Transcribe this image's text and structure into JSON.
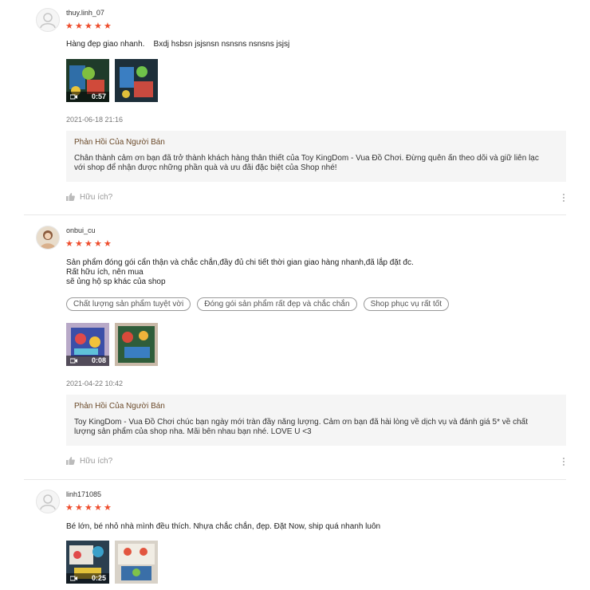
{
  "reviews": [
    {
      "username": "thuy.linh_07",
      "avatar": "default-avatar",
      "rating": 5,
      "stars": [
        "★",
        "★",
        "★",
        "★",
        "★"
      ],
      "text": "Hàng đẹp giao nhanh.    Bxdj hsbsn jsjsnsn nsnsns nsnsns jsjsj",
      "media": [
        {
          "type": "video",
          "duration": "0:57"
        },
        {
          "type": "image"
        }
      ],
      "datetime": "2021-06-18 21:16",
      "seller_reply": {
        "title": "Phản Hồi Của Người Bán",
        "line1": "Chân thành cảm ơn bạn đã trở thành khách hàng thân thiết của Toy KingDom - Vua Đồ Chơi. Đừng quên ấn theo dõi và giữ liên lạc",
        "line2": "với shop để nhận được những phần quà và ưu đãi đặc biệt của Shop nhé!"
      },
      "helpful_label": "Hữu ích?"
    },
    {
      "username": "onbui_cu",
      "avatar": "photo-avatar",
      "rating": 5,
      "stars": [
        "★",
        "★",
        "★",
        "★",
        "★"
      ],
      "text_lines": [
        "Sản phẩm đóng gói cẩn thận và chắc chắn,đầy đủ chi tiết thời gian giao hàng nhanh,đã lắp đặt đc.",
        "Rất hữu ích, nên mua",
        "sẽ ủng hộ sp khác của shop"
      ],
      "tags": [
        "Chất lượng sản phẩm tuyệt vời",
        "Đóng gói sản phẩm rất đẹp và chắc chắn",
        "Shop phục vụ rất tốt"
      ],
      "media": [
        {
          "type": "video",
          "duration": "0:08"
        },
        {
          "type": "image"
        }
      ],
      "datetime": "2021-04-22 10:42",
      "seller_reply": {
        "title": "Phản Hồi Của Người Bán",
        "line1": "Toy KingDom - Vua Đồ Chơi chúc bạn ngày mới tràn đầy năng lượng. Cảm ơn bạn đã hài lòng về dịch vụ và đánh giá 5* về chất",
        "line2": "lượng sản phẩm của shop nha. Mãi bên nhau bạn nhé. LOVE U <3"
      },
      "helpful_label": "Hữu ích?"
    },
    {
      "username": "linh171085",
      "avatar": "default-avatar",
      "rating": 5,
      "stars": [
        "★",
        "★",
        "★",
        "★",
        "★"
      ],
      "text": "Bé lớn, bé nhỏ nhà mình đều thích. Nhựa chắc chắn, đẹp. Đặt Now, ship quá nhanh luôn",
      "media": [
        {
          "type": "video",
          "duration": "0:25"
        },
        {
          "type": "image"
        }
      ]
    }
  ],
  "colors": {
    "star": "#ee4d2d",
    "reply_bg": "#f5f5f5",
    "reply_title": "#6b4a2a",
    "divider": "#e8e8e8"
  }
}
